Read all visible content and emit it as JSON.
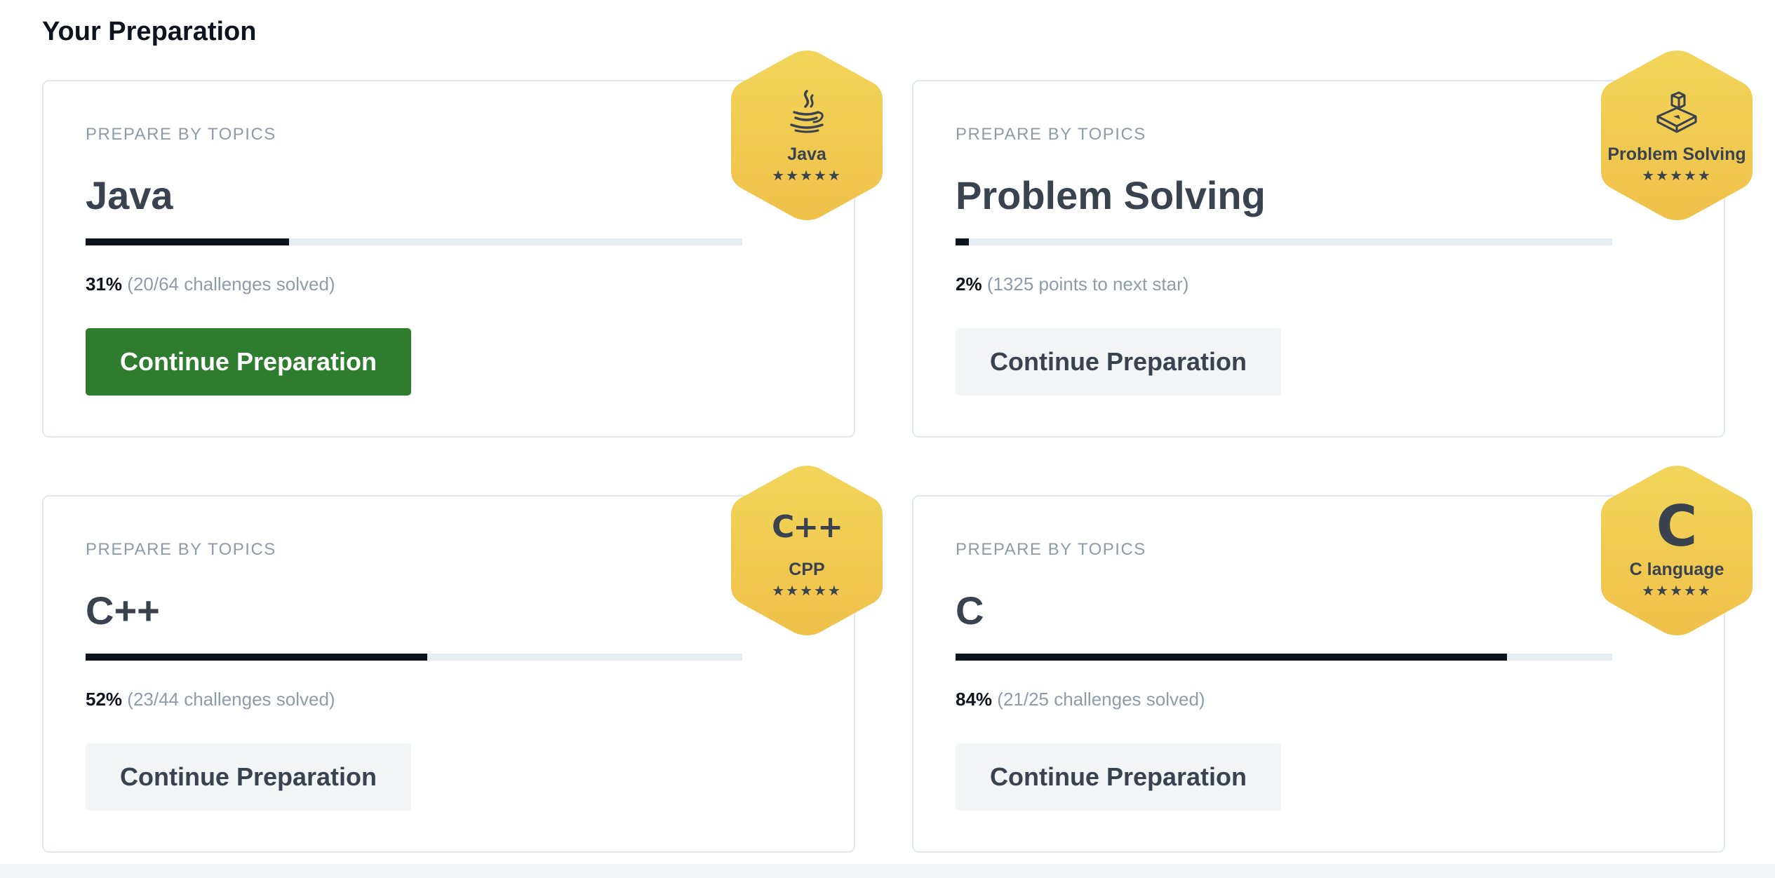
{
  "page": {
    "title": "Your Preparation"
  },
  "cards": [
    {
      "kicker": "PREPARE BY TOPICS",
      "name": "Java",
      "progress": 0.31,
      "percent_text": "31%",
      "detail_text": "(20/64 challenges solved)",
      "button_label": "Continue Preparation",
      "button_style": "primary",
      "badge": {
        "label": "Java",
        "stars": "★★★★★",
        "icon": "java-cup-icon"
      }
    },
    {
      "kicker": "PREPARE BY TOPICS",
      "name": "Problem Solving",
      "progress": 0.02,
      "percent_text": "2%",
      "detail_text": "(1325 points to next star)",
      "button_label": "Continue Preparation",
      "button_style": "secondary",
      "badge": {
        "label": "Problem Solving",
        "stars": "★★★★★",
        "icon": "cube-icon"
      }
    },
    {
      "kicker": "PREPARE BY TOPICS",
      "name": "C++",
      "progress": 0.52,
      "percent_text": "52%",
      "detail_text": "(23/44 challenges solved)",
      "button_label": "Continue Preparation",
      "button_style": "secondary",
      "badge": {
        "label": "CPP",
        "stars": "★★★★★",
        "icon": "cpp-icon",
        "icon_text": "C++"
      }
    },
    {
      "kicker": "PREPARE BY TOPICS",
      "name": "C",
      "progress": 0.84,
      "percent_text": "84%",
      "detail_text": "(21/25 challenges solved)",
      "button_label": "Continue Preparation",
      "button_style": "secondary",
      "badge": {
        "label": "C language",
        "stars": "★★★★★",
        "icon": "c-language-icon",
        "icon_text": "C"
      }
    }
  ],
  "colors": {
    "primary_button": "#2e7d2e",
    "badge_gold_top": "#f2d55a",
    "badge_gold_bottom": "#efc04a",
    "progress_fill": "#0e141e",
    "progress_track": "#e7eef1"
  }
}
